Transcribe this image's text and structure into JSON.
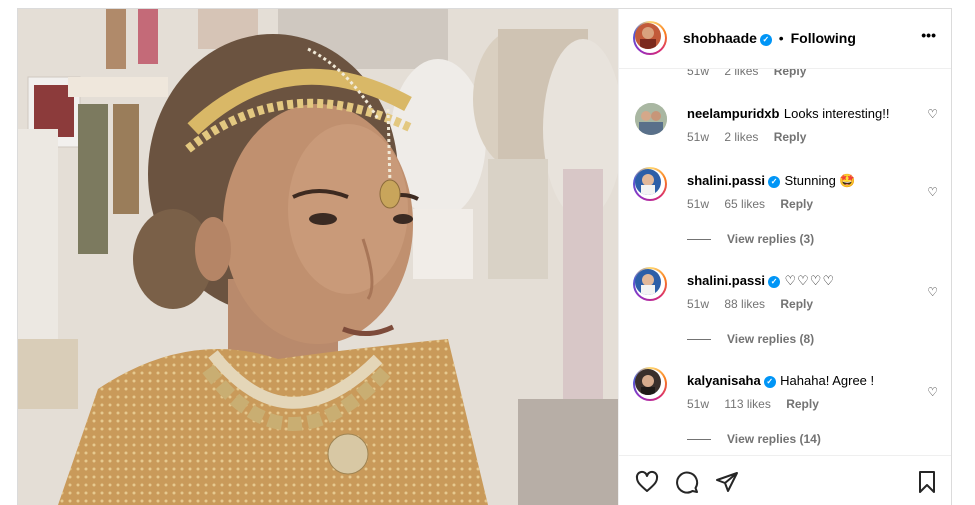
{
  "post": {
    "author": "shobhaade",
    "follow_status": "Following",
    "separator": "•",
    "more_label": "•••"
  },
  "partial_meta": {
    "time": "51w",
    "likes": "2 likes",
    "reply": "Reply"
  },
  "comments": [
    {
      "username": "neelampuridxb",
      "verified": false,
      "text": "Looks interesting!!",
      "time": "51w",
      "likes": "2 likes",
      "reply": "Reply",
      "view_replies": ""
    },
    {
      "username": "shalini.passi",
      "verified": true,
      "text": "Stunning 🤩",
      "time": "51w",
      "likes": "65 likes",
      "reply": "Reply",
      "view_replies": "View replies (3)"
    },
    {
      "username": "shalini.passi",
      "verified": true,
      "text": "♡♡♡♡",
      "time": "51w",
      "likes": "88 likes",
      "reply": "Reply",
      "view_replies": "View replies (8)"
    },
    {
      "username": "kalyanisaha",
      "verified": true,
      "text": "Hahaha! Agree !",
      "time": "51w",
      "likes": "113 likes",
      "reply": "Reply",
      "view_replies": "View replies (14)"
    }
  ],
  "icons": {
    "verified": "verified-badge-icon",
    "like": "heart-icon",
    "comment": "comment-bubble-icon",
    "share": "paper-plane-icon",
    "save": "bookmark-icon"
  },
  "colors": {
    "verified": "#0095f6",
    "meta": "#737373",
    "border": "#dbdbdb"
  }
}
